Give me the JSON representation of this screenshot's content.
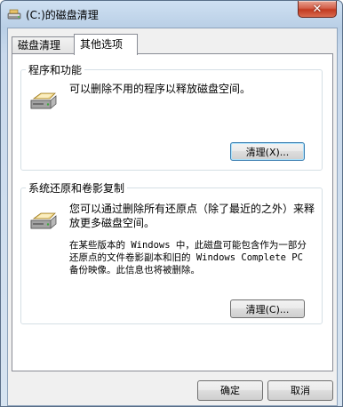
{
  "window": {
    "title": "(C:)的磁盘清理",
    "close_glyph": "✕"
  },
  "tabs": [
    {
      "label": "磁盘清理",
      "active": false
    },
    {
      "label": "其他选项",
      "active": true
    }
  ],
  "programs_section": {
    "title": "程序和功能",
    "description": "可以删除不用的程序以释放磁盘空间。",
    "button_label": "清理(X)..."
  },
  "restore_section": {
    "title": "系统还原和卷影复制",
    "description_1": "您可以通过删除所有还原点（除了最近的之外）来释放更多磁盘空间。",
    "description_2": "在某些版本的 Windows 中，此磁盘可能包含作为一部分还原点的文件卷影副本和旧的 Windows Complete PC 备份映像。此信息也将被删除。",
    "button_label": "清理(C)..."
  },
  "footer": {
    "ok_label": "确定",
    "cancel_label": "取消"
  },
  "colors": {
    "accent": "#3c7fb1",
    "close_button": "#c23a21"
  },
  "icons": [
    "drive-cleanup-icon",
    "close-icon",
    "disk-drive-icon"
  ]
}
